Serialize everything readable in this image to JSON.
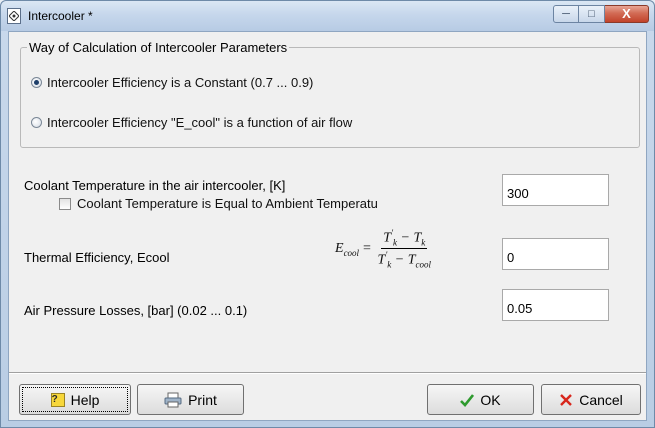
{
  "window": {
    "title": "Intercooler *"
  },
  "group": {
    "legend": "Way of Calculation of Intercooler Parameters",
    "options": [
      {
        "label": "Intercooler Efficiency is a Constant (0.7 ... 0.9)",
        "checked": true
      },
      {
        "label": "Intercooler Efficiency \"E_cool\" is a function of air flow",
        "checked": false
      }
    ]
  },
  "coolant": {
    "label": "Coolant Temperature in the air intercooler, [K]",
    "value": "300",
    "checkbox_label": "Coolant Temperature is Equal to Ambient Temperatu",
    "checkbox_checked": false
  },
  "thermal": {
    "label": "Thermal Efficiency, Ecool",
    "value": "0",
    "formula": {
      "lhs": "E",
      "lhs_sub": "cool",
      "eq": "=",
      "num_a": "T",
      "num_a_sup": "'",
      "num_a_sub": "k",
      "minus": "−",
      "num_b": "T",
      "num_b_sub": "k",
      "den_a": "T",
      "den_a_sup": "'",
      "den_a_sub": "k",
      "den_b": "T",
      "den_b_sub": "cool"
    }
  },
  "pressure": {
    "label": "Air Pressure Losses, [bar] (0.02 ... 0.1)",
    "value": "0.05"
  },
  "buttons": {
    "help": "Help",
    "help_glyph": "?",
    "print": "Print",
    "ok": "OK",
    "cancel": "Cancel"
  },
  "icons": {
    "app": "app-icon",
    "help": "help-icon",
    "print": "printer-icon",
    "ok": "checkmark-icon",
    "cancel": "x-icon"
  },
  "colors": {
    "ok_check": "#2e9a2e",
    "cancel_x": "#d8261c",
    "close_button": "#c2432b"
  }
}
